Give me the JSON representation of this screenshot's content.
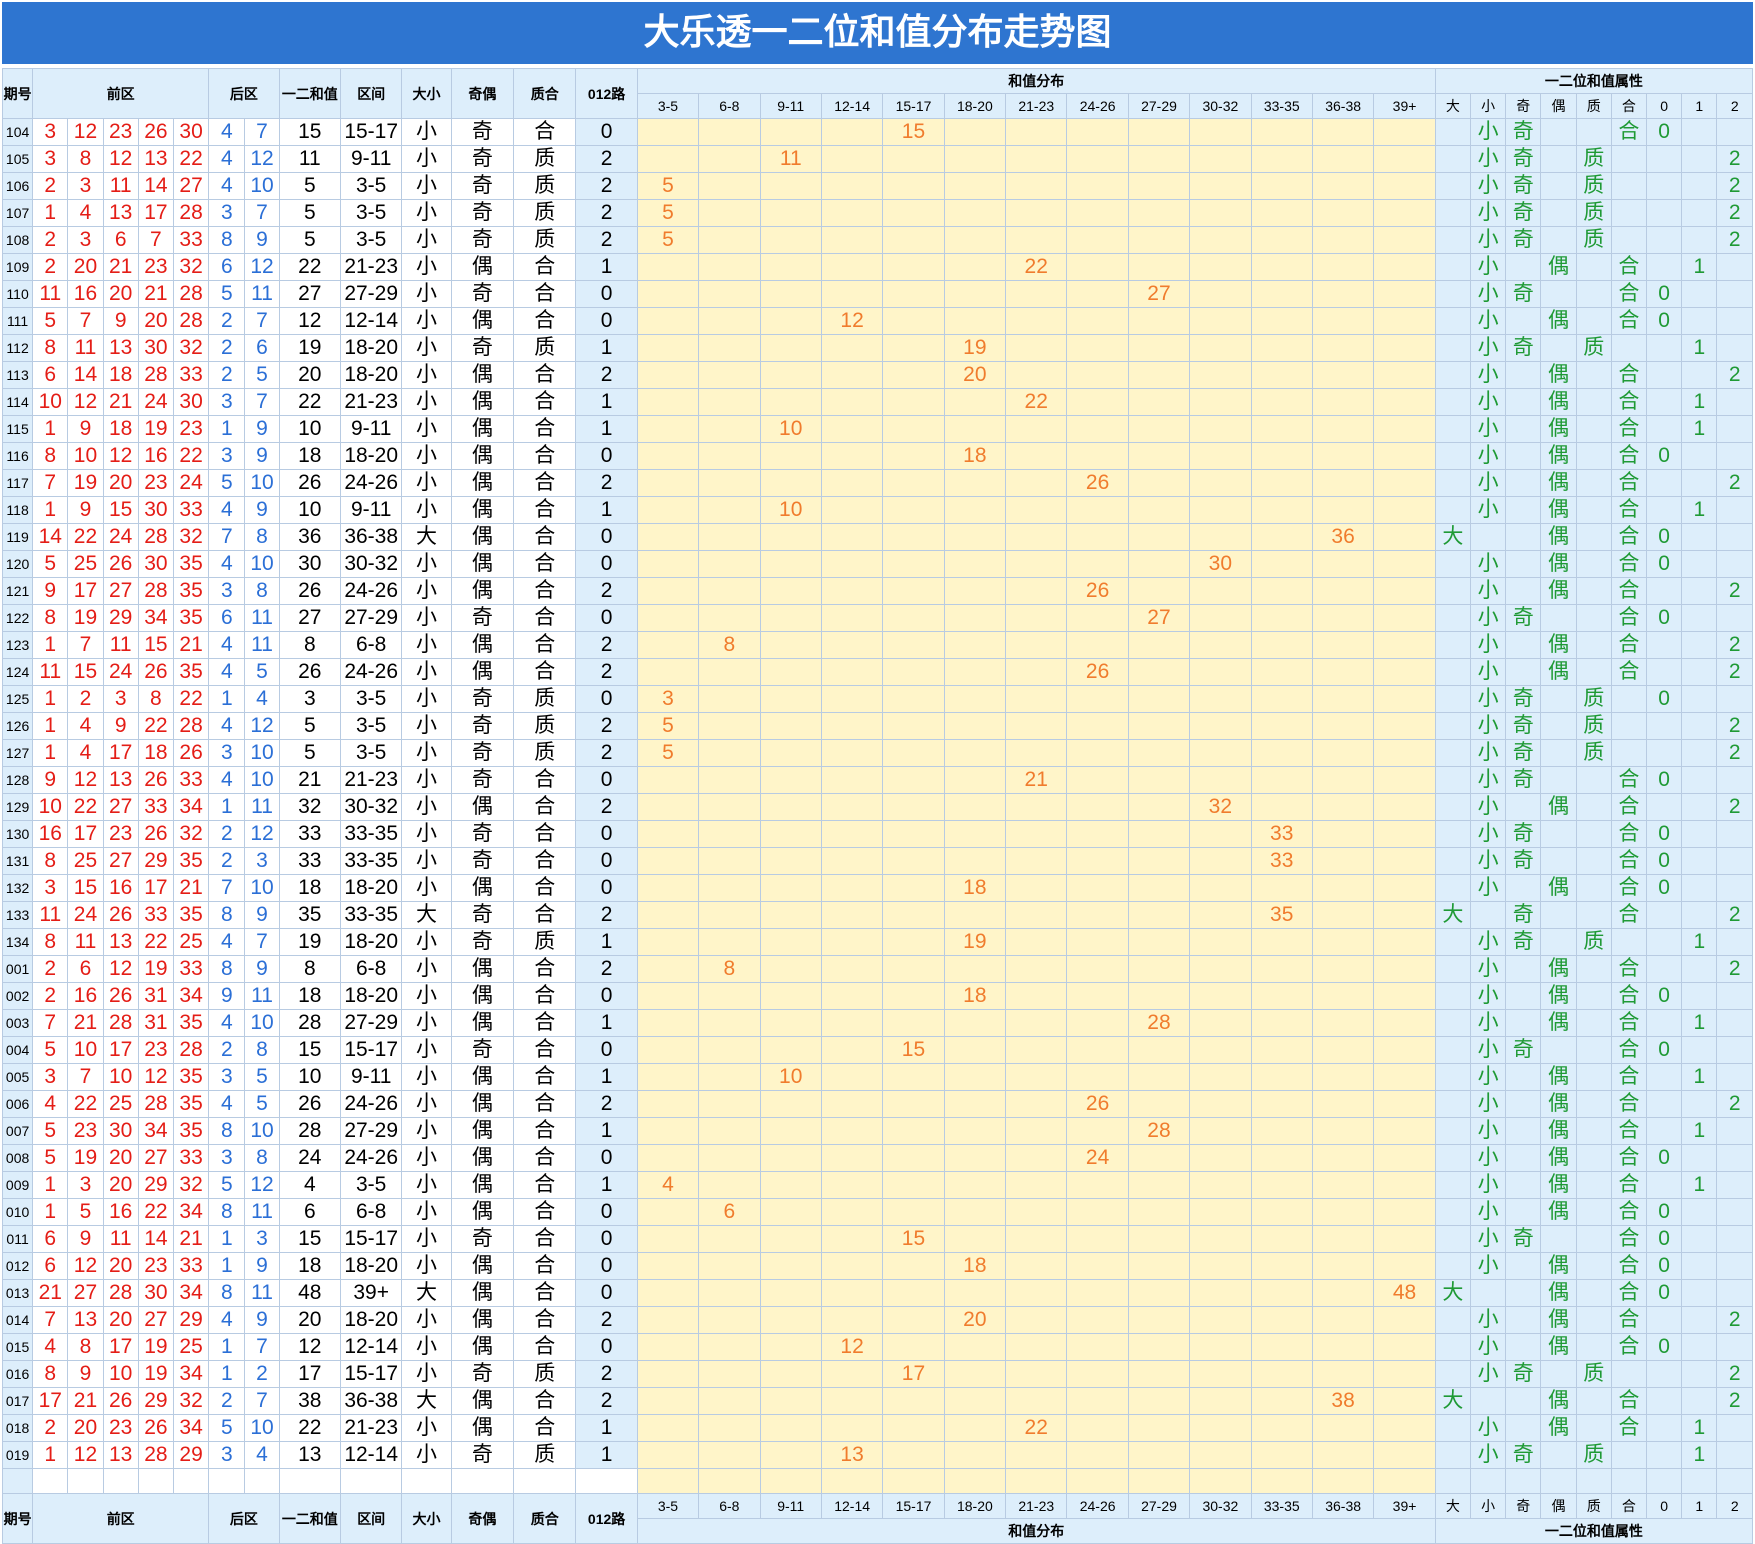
{
  "title": "大乐透一二位和值分布走势图",
  "headers": {
    "period": "期号",
    "front": "前区",
    "back": "后区",
    "sum": "一二和值",
    "interval": "区间",
    "size": "大小",
    "parity": "奇偶",
    "prime": "质合",
    "route": "012路",
    "dist": "和值分布",
    "attr": "一二位和值属性"
  },
  "ranges": [
    "3-5",
    "6-8",
    "9-11",
    "12-14",
    "15-17",
    "18-20",
    "21-23",
    "24-26",
    "27-29",
    "30-32",
    "33-35",
    "36-38",
    "39+"
  ],
  "attr_cols": [
    "大",
    "小",
    "奇",
    "偶",
    "质",
    "合",
    "0",
    "1",
    "2"
  ],
  "rows": [
    {
      "p": "104",
      "f": [
        3,
        12,
        23,
        26,
        30
      ],
      "b": [
        4,
        7
      ],
      "s": 15,
      "r": "15-17",
      "sz": "小",
      "oe": "奇",
      "pr": "合",
      "m": 0
    },
    {
      "p": "105",
      "f": [
        3,
        8,
        12,
        13,
        22
      ],
      "b": [
        4,
        12
      ],
      "s": 11,
      "r": "9-11",
      "sz": "小",
      "oe": "奇",
      "pr": "质",
      "m": 2
    },
    {
      "p": "106",
      "f": [
        2,
        3,
        11,
        14,
        27
      ],
      "b": [
        4,
        10
      ],
      "s": 5,
      "r": "3-5",
      "sz": "小",
      "oe": "奇",
      "pr": "质",
      "m": 2
    },
    {
      "p": "107",
      "f": [
        1,
        4,
        13,
        17,
        28
      ],
      "b": [
        3,
        7
      ],
      "s": 5,
      "r": "3-5",
      "sz": "小",
      "oe": "奇",
      "pr": "质",
      "m": 2
    },
    {
      "p": "108",
      "f": [
        2,
        3,
        6,
        7,
        33
      ],
      "b": [
        8,
        9
      ],
      "s": 5,
      "r": "3-5",
      "sz": "小",
      "oe": "奇",
      "pr": "质",
      "m": 2
    },
    {
      "p": "109",
      "f": [
        2,
        20,
        21,
        23,
        32
      ],
      "b": [
        6,
        12
      ],
      "s": 22,
      "r": "21-23",
      "sz": "小",
      "oe": "偶",
      "pr": "合",
      "m": 1
    },
    {
      "p": "110",
      "f": [
        11,
        16,
        20,
        21,
        28
      ],
      "b": [
        5,
        11
      ],
      "s": 27,
      "r": "27-29",
      "sz": "小",
      "oe": "奇",
      "pr": "合",
      "m": 0
    },
    {
      "p": "111",
      "f": [
        5,
        7,
        9,
        20,
        28
      ],
      "b": [
        2,
        7
      ],
      "s": 12,
      "r": "12-14",
      "sz": "小",
      "oe": "偶",
      "pr": "合",
      "m": 0
    },
    {
      "p": "112",
      "f": [
        8,
        11,
        13,
        30,
        32
      ],
      "b": [
        2,
        6
      ],
      "s": 19,
      "r": "18-20",
      "sz": "小",
      "oe": "奇",
      "pr": "质",
      "m": 1
    },
    {
      "p": "113",
      "f": [
        6,
        14,
        18,
        28,
        33
      ],
      "b": [
        2,
        5
      ],
      "s": 20,
      "r": "18-20",
      "sz": "小",
      "oe": "偶",
      "pr": "合",
      "m": 2
    },
    {
      "p": "114",
      "f": [
        10,
        12,
        21,
        24,
        30
      ],
      "b": [
        3,
        7
      ],
      "s": 22,
      "r": "21-23",
      "sz": "小",
      "oe": "偶",
      "pr": "合",
      "m": 1
    },
    {
      "p": "115",
      "f": [
        1,
        9,
        18,
        19,
        23
      ],
      "b": [
        1,
        9
      ],
      "s": 10,
      "r": "9-11",
      "sz": "小",
      "oe": "偶",
      "pr": "合",
      "m": 1
    },
    {
      "p": "116",
      "f": [
        8,
        10,
        12,
        16,
        22
      ],
      "b": [
        3,
        9
      ],
      "s": 18,
      "r": "18-20",
      "sz": "小",
      "oe": "偶",
      "pr": "合",
      "m": 0
    },
    {
      "p": "117",
      "f": [
        7,
        19,
        20,
        23,
        24
      ],
      "b": [
        5,
        10
      ],
      "s": 26,
      "r": "24-26",
      "sz": "小",
      "oe": "偶",
      "pr": "合",
      "m": 2
    },
    {
      "p": "118",
      "f": [
        1,
        9,
        15,
        30,
        33
      ],
      "b": [
        4,
        9
      ],
      "s": 10,
      "r": "9-11",
      "sz": "小",
      "oe": "偶",
      "pr": "合",
      "m": 1
    },
    {
      "p": "119",
      "f": [
        14,
        22,
        24,
        28,
        32
      ],
      "b": [
        7,
        8
      ],
      "s": 36,
      "r": "36-38",
      "sz": "大",
      "oe": "偶",
      "pr": "合",
      "m": 0
    },
    {
      "p": "120",
      "f": [
        5,
        25,
        26,
        30,
        35
      ],
      "b": [
        4,
        10
      ],
      "s": 30,
      "r": "30-32",
      "sz": "小",
      "oe": "偶",
      "pr": "合",
      "m": 0
    },
    {
      "p": "121",
      "f": [
        9,
        17,
        27,
        28,
        35
      ],
      "b": [
        3,
        8
      ],
      "s": 26,
      "r": "24-26",
      "sz": "小",
      "oe": "偶",
      "pr": "合",
      "m": 2
    },
    {
      "p": "122",
      "f": [
        8,
        19,
        29,
        34,
        35
      ],
      "b": [
        6,
        11
      ],
      "s": 27,
      "r": "27-29",
      "sz": "小",
      "oe": "奇",
      "pr": "合",
      "m": 0
    },
    {
      "p": "123",
      "f": [
        1,
        7,
        11,
        15,
        21
      ],
      "b": [
        4,
        11
      ],
      "s": 8,
      "r": "6-8",
      "sz": "小",
      "oe": "偶",
      "pr": "合",
      "m": 2
    },
    {
      "p": "124",
      "f": [
        11,
        15,
        24,
        26,
        35
      ],
      "b": [
        4,
        5
      ],
      "s": 26,
      "r": "24-26",
      "sz": "小",
      "oe": "偶",
      "pr": "合",
      "m": 2
    },
    {
      "p": "125",
      "f": [
        1,
        2,
        3,
        8,
        22
      ],
      "b": [
        1,
        4
      ],
      "s": 3,
      "r": "3-5",
      "sz": "小",
      "oe": "奇",
      "pr": "质",
      "m": 0
    },
    {
      "p": "126",
      "f": [
        1,
        4,
        9,
        22,
        28
      ],
      "b": [
        4,
        12
      ],
      "s": 5,
      "r": "3-5",
      "sz": "小",
      "oe": "奇",
      "pr": "质",
      "m": 2
    },
    {
      "p": "127",
      "f": [
        1,
        4,
        17,
        18,
        26
      ],
      "b": [
        3,
        10
      ],
      "s": 5,
      "r": "3-5",
      "sz": "小",
      "oe": "奇",
      "pr": "质",
      "m": 2
    },
    {
      "p": "128",
      "f": [
        9,
        12,
        13,
        26,
        33
      ],
      "b": [
        4,
        10
      ],
      "s": 21,
      "r": "21-23",
      "sz": "小",
      "oe": "奇",
      "pr": "合",
      "m": 0
    },
    {
      "p": "129",
      "f": [
        10,
        22,
        27,
        33,
        34
      ],
      "b": [
        1,
        11
      ],
      "s": 32,
      "r": "30-32",
      "sz": "小",
      "oe": "偶",
      "pr": "合",
      "m": 2
    },
    {
      "p": "130",
      "f": [
        16,
        17,
        23,
        26,
        32
      ],
      "b": [
        2,
        12
      ],
      "s": 33,
      "r": "33-35",
      "sz": "小",
      "oe": "奇",
      "pr": "合",
      "m": 0
    },
    {
      "p": "131",
      "f": [
        8,
        25,
        27,
        29,
        35
      ],
      "b": [
        2,
        3
      ],
      "s": 33,
      "r": "33-35",
      "sz": "小",
      "oe": "奇",
      "pr": "合",
      "m": 0
    },
    {
      "p": "132",
      "f": [
        3,
        15,
        16,
        17,
        21
      ],
      "b": [
        7,
        10
      ],
      "s": 18,
      "r": "18-20",
      "sz": "小",
      "oe": "偶",
      "pr": "合",
      "m": 0
    },
    {
      "p": "133",
      "f": [
        11,
        24,
        26,
        33,
        35
      ],
      "b": [
        8,
        9
      ],
      "s": 35,
      "r": "33-35",
      "sz": "大",
      "oe": "奇",
      "pr": "合",
      "m": 2
    },
    {
      "p": "134",
      "f": [
        8,
        11,
        13,
        22,
        25
      ],
      "b": [
        4,
        7
      ],
      "s": 19,
      "r": "18-20",
      "sz": "小",
      "oe": "奇",
      "pr": "质",
      "m": 1
    },
    {
      "p": "001",
      "f": [
        2,
        6,
        12,
        19,
        33
      ],
      "b": [
        8,
        9
      ],
      "s": 8,
      "r": "6-8",
      "sz": "小",
      "oe": "偶",
      "pr": "合",
      "m": 2
    },
    {
      "p": "002",
      "f": [
        2,
        16,
        26,
        31,
        34
      ],
      "b": [
        9,
        11
      ],
      "s": 18,
      "r": "18-20",
      "sz": "小",
      "oe": "偶",
      "pr": "合",
      "m": 0
    },
    {
      "p": "003",
      "f": [
        7,
        21,
        28,
        31,
        35
      ],
      "b": [
        4,
        10
      ],
      "s": 28,
      "r": "27-29",
      "sz": "小",
      "oe": "偶",
      "pr": "合",
      "m": 1
    },
    {
      "p": "004",
      "f": [
        5,
        10,
        17,
        23,
        28
      ],
      "b": [
        2,
        8
      ],
      "s": 15,
      "r": "15-17",
      "sz": "小",
      "oe": "奇",
      "pr": "合",
      "m": 0
    },
    {
      "p": "005",
      "f": [
        3,
        7,
        10,
        12,
        35
      ],
      "b": [
        3,
        5
      ],
      "s": 10,
      "r": "9-11",
      "sz": "小",
      "oe": "偶",
      "pr": "合",
      "m": 1
    },
    {
      "p": "006",
      "f": [
        4,
        22,
        25,
        28,
        35
      ],
      "b": [
        4,
        5
      ],
      "s": 26,
      "r": "24-26",
      "sz": "小",
      "oe": "偶",
      "pr": "合",
      "m": 2
    },
    {
      "p": "007",
      "f": [
        5,
        23,
        30,
        34,
        35
      ],
      "b": [
        8,
        10
      ],
      "s": 28,
      "r": "27-29",
      "sz": "小",
      "oe": "偶",
      "pr": "合",
      "m": 1
    },
    {
      "p": "008",
      "f": [
        5,
        19,
        20,
        27,
        33
      ],
      "b": [
        3,
        8
      ],
      "s": 24,
      "r": "24-26",
      "sz": "小",
      "oe": "偶",
      "pr": "合",
      "m": 0
    },
    {
      "p": "009",
      "f": [
        1,
        3,
        20,
        29,
        32
      ],
      "b": [
        5,
        12
      ],
      "s": 4,
      "r": "3-5",
      "sz": "小",
      "oe": "偶",
      "pr": "合",
      "m": 1
    },
    {
      "p": "010",
      "f": [
        1,
        5,
        16,
        22,
        34
      ],
      "b": [
        8,
        11
      ],
      "s": 6,
      "r": "6-8",
      "sz": "小",
      "oe": "偶",
      "pr": "合",
      "m": 0
    },
    {
      "p": "011",
      "f": [
        6,
        9,
        11,
        14,
        21
      ],
      "b": [
        1,
        3
      ],
      "s": 15,
      "r": "15-17",
      "sz": "小",
      "oe": "奇",
      "pr": "合",
      "m": 0
    },
    {
      "p": "012",
      "f": [
        6,
        12,
        20,
        23,
        33
      ],
      "b": [
        1,
        9
      ],
      "s": 18,
      "r": "18-20",
      "sz": "小",
      "oe": "偶",
      "pr": "合",
      "m": 0
    },
    {
      "p": "013",
      "f": [
        21,
        27,
        28,
        30,
        34
      ],
      "b": [
        8,
        11
      ],
      "s": 48,
      "r": "39+",
      "sz": "大",
      "oe": "偶",
      "pr": "合",
      "m": 0
    },
    {
      "p": "014",
      "f": [
        7,
        13,
        20,
        27,
        29
      ],
      "b": [
        4,
        9
      ],
      "s": 20,
      "r": "18-20",
      "sz": "小",
      "oe": "偶",
      "pr": "合",
      "m": 2
    },
    {
      "p": "015",
      "f": [
        4,
        8,
        17,
        19,
        25
      ],
      "b": [
        1,
        7
      ],
      "s": 12,
      "r": "12-14",
      "sz": "小",
      "oe": "偶",
      "pr": "合",
      "m": 0
    },
    {
      "p": "016",
      "f": [
        8,
        9,
        10,
        19,
        34
      ],
      "b": [
        1,
        2
      ],
      "s": 17,
      "r": "15-17",
      "sz": "小",
      "oe": "奇",
      "pr": "质",
      "m": 2
    },
    {
      "p": "017",
      "f": [
        17,
        21,
        26,
        29,
        32
      ],
      "b": [
        2,
        7
      ],
      "s": 38,
      "r": "36-38",
      "sz": "大",
      "oe": "偶",
      "pr": "合",
      "m": 2
    },
    {
      "p": "018",
      "f": [
        2,
        20,
        23,
        26,
        34
      ],
      "b": [
        5,
        10
      ],
      "s": 22,
      "r": "21-23",
      "sz": "小",
      "oe": "偶",
      "pr": "合",
      "m": 1
    },
    {
      "p": "019",
      "f": [
        1,
        12,
        13,
        28,
        29
      ],
      "b": [
        3,
        4
      ],
      "s": 13,
      "r": "12-14",
      "sz": "小",
      "oe": "奇",
      "pr": "质",
      "m": 1
    }
  ]
}
